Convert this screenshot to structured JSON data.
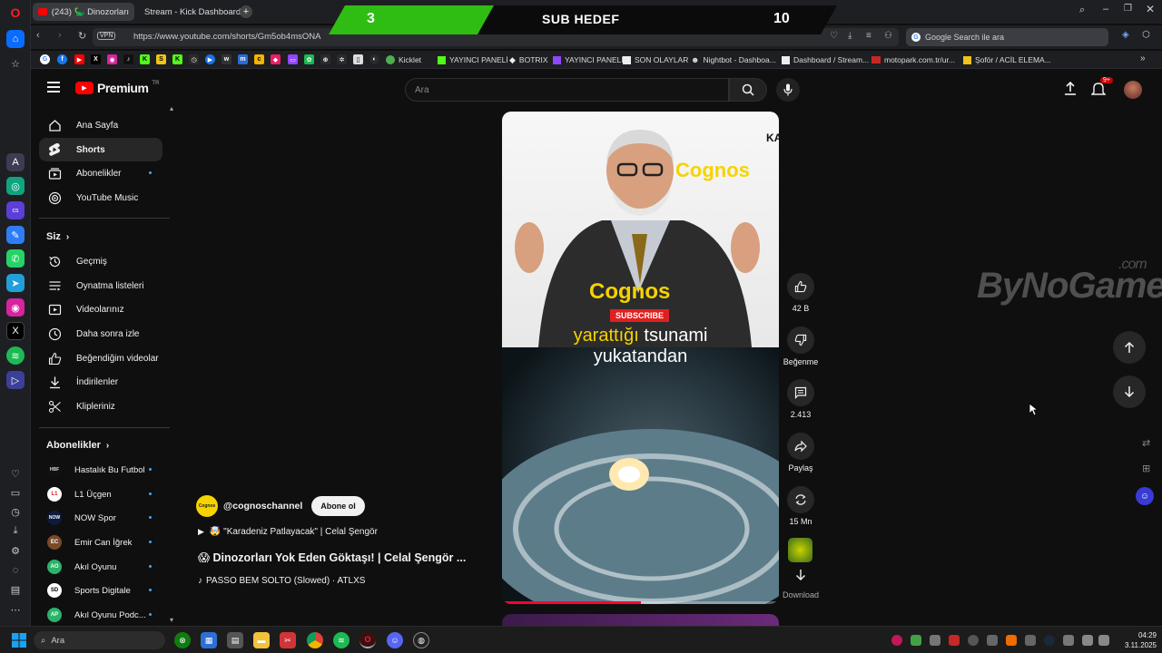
{
  "browser": {
    "tabs": [
      {
        "label": "(243) 🦕 Dinozorları"
      },
      {
        "label": "Stream - Kick Dashboard"
      }
    ],
    "url": "https://www.youtube.com/shorts/Gm5ob4msONA",
    "vpn_label": "VPN",
    "google_search_placeholder": "Google Search ile ara"
  },
  "bookmarks": [
    {
      "label": "Kicklet"
    },
    {
      "label": "YAYINCI PANELİ"
    },
    {
      "label": "BOTRIX"
    },
    {
      "label": "YAYINCI PANELİ"
    },
    {
      "label": "SON OLAYLAR"
    },
    {
      "label": "Nightbot - Dashboa..."
    },
    {
      "label": "Dashboard / Stream..."
    },
    {
      "label": "motopark.com.tr/ur..."
    },
    {
      "label": "Şoför / ACİL ELEMA..."
    }
  ],
  "overlay": {
    "left_count": "3",
    "title": "SUB HEDEF",
    "right_count": "10"
  },
  "youtube": {
    "logo_text": "Premium",
    "logo_badge": "TR",
    "search_placeholder": "Ara",
    "notification_count": "9+",
    "nav_main": [
      {
        "label": "Ana Sayfa"
      },
      {
        "label": "Shorts"
      },
      {
        "label": "Abonelikler"
      },
      {
        "label": "YouTube Music"
      }
    ],
    "you_title": "Siz",
    "nav_you": [
      {
        "label": "Geçmiş"
      },
      {
        "label": "Oynatma listeleri"
      },
      {
        "label": "Videolarınız"
      },
      {
        "label": "Daha sonra izle"
      },
      {
        "label": "Beğendiğim videolar"
      },
      {
        "label": "İndirilenler"
      },
      {
        "label": "Klipleriniz"
      }
    ],
    "subs_title": "Abonelikler",
    "subscriptions": [
      {
        "label": "Hastalık Bu Futbol",
        "avatar": "HBF"
      },
      {
        "label": "L1 Üçgen",
        "avatar": "L1"
      },
      {
        "label": "NOW Spor",
        "avatar": "NOW"
      },
      {
        "label": "Emir Can İğrek",
        "avatar": "EC"
      },
      {
        "label": "Akıl Oyunu",
        "avatar": "AO"
      },
      {
        "label": "Sports Digitale",
        "avatar": "SD"
      },
      {
        "label": "Akıl Oyunu Podc...",
        "avatar": "AP"
      }
    ],
    "short": {
      "channel": "@cognoschannel",
      "channel_avatar": "Cognos",
      "subscribe_label": "Abone ol",
      "playlist_line": "🤯 \"Karadeniz Patlayacak\" | Celal Şengör",
      "title": "😱 Dinozorları Yok Eden Göktaşı! | Celal Şengör ...",
      "music": "PASSO BEM SOLTO (Slowed) · ATLXS",
      "progress": 0.5,
      "video_text": {
        "brand_top": "Cognos",
        "corner": "KA",
        "brand_mid": "Cognos",
        "subscribe": "SUBSCRIBE",
        "caption_line1_yellow": "yarattığı",
        "caption_line1_white": "tsunami",
        "caption_line2": "yukatandan"
      }
    },
    "actions": {
      "likes": "42 B",
      "dislike": "Beğenme",
      "comments": "2.413",
      "share": "Paylaş",
      "remix": "15 Mn",
      "download": "Download"
    },
    "watermark": "ByNoGame",
    "watermark_suffix": ".com"
  },
  "taskbar": {
    "search_placeholder": "Ara",
    "time": "04:29",
    "date": "3.11.2025"
  },
  "colors": {
    "youtube_red": "#ff0000",
    "banner_green": "#53fc18",
    "cognos_yellow": "#f5d300",
    "link_blue": "#3ea6ff"
  }
}
